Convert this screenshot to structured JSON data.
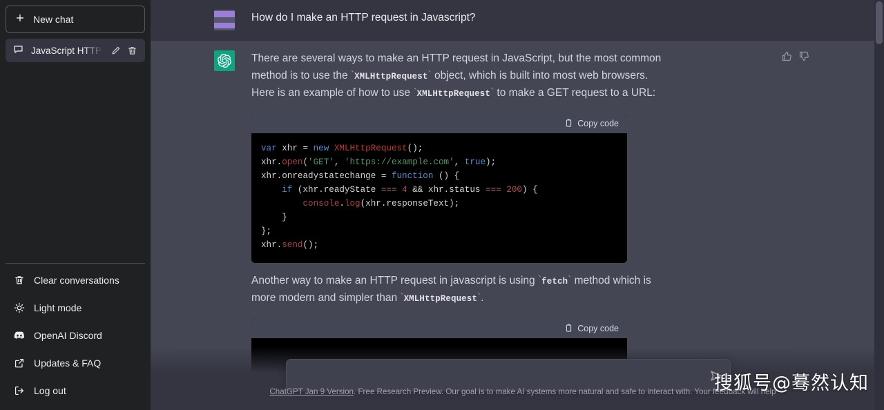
{
  "colors": {
    "sidebar_bg": "#202123",
    "user_row_bg": "#343541",
    "bot_row_bg": "#444654",
    "accent_green": "#10a37f",
    "code_bg": "#000000",
    "code_head_bg": "#434654",
    "composer_bg": "#40414f",
    "text_primary": "#ececf1",
    "text_secondary": "#d1d5db",
    "avatar_user": "#9b7ddc"
  },
  "sidebar": {
    "new_chat_label": "New chat",
    "new_chat_icon": "plus-icon",
    "chats": [
      {
        "title": "JavaScript HTTP requ",
        "icon": "chat-bubble-icon",
        "edit_icon": "pencil-icon",
        "delete_icon": "trash-icon",
        "active": true
      }
    ],
    "menu": [
      {
        "label": "Clear conversations",
        "icon": "trash-icon"
      },
      {
        "label": "Light mode",
        "icon": "sun-icon"
      },
      {
        "label": "OpenAI Discord",
        "icon": "discord-icon"
      },
      {
        "label": "Updates & FAQ",
        "icon": "external-link-icon"
      },
      {
        "label": "Log out",
        "icon": "logout-icon"
      }
    ]
  },
  "conversation": {
    "messages": [
      {
        "role": "user",
        "avatar_icon": "user-avatar",
        "text": "How do I make an HTTP request in Javascript?"
      },
      {
        "role": "assistant",
        "avatar_icon": "openai-logo-icon",
        "feedback": {
          "thumbs_up_icon": "thumbs-up-icon",
          "thumbs_down_icon": "thumbs-down-icon"
        },
        "paragraph_1": {
          "part_1": "There are several ways to make an HTTP request in JavaScript, but the most common method is to use the ",
          "code_1": "XMLHttpRequest",
          "part_2": " object, which is built into most web browsers. Here is an example of how to use ",
          "code_2": "XMLHttpRequest",
          "part_3": " to make a GET request to a URL:"
        },
        "code_block_1": {
          "copy_label": "Copy code",
          "copy_icon": "clipboard-icon",
          "language": "javascript",
          "lines": [
            [
              {
                "t": "var ",
                "c": "k-kw"
              },
              {
                "t": "xhr ",
                "c": "k-plain"
              },
              {
                "t": "= ",
                "c": "k-plain"
              },
              {
                "t": "new ",
                "c": "k-kw"
              },
              {
                "t": "XMLHttpRequest",
                "c": "k-cls"
              },
              {
                "t": "();",
                "c": "k-plain"
              }
            ],
            [
              {
                "t": "xhr.",
                "c": "k-plain"
              },
              {
                "t": "open",
                "c": "k-fn"
              },
              {
                "t": "(",
                "c": "k-plain"
              },
              {
                "t": "'GET'",
                "c": "k-str"
              },
              {
                "t": ", ",
                "c": "k-plain"
              },
              {
                "t": "'https://example.com'",
                "c": "k-str"
              },
              {
                "t": ", ",
                "c": "k-plain"
              },
              {
                "t": "true",
                "c": "k-kw"
              },
              {
                "t": ");",
                "c": "k-plain"
              }
            ],
            [
              {
                "t": "xhr.onreadystatechange = ",
                "c": "k-plain"
              },
              {
                "t": "function",
                "c": "k-kw"
              },
              {
                "t": " () {",
                "c": "k-plain"
              }
            ],
            [
              {
                "t": "    ",
                "c": "k-plain"
              },
              {
                "t": "if",
                "c": "k-kw"
              },
              {
                "t": " (xhr.readyState ",
                "c": "k-plain"
              },
              {
                "t": "===",
                "c": "k-op"
              },
              {
                "t": " ",
                "c": "k-plain"
              },
              {
                "t": "4",
                "c": "k-num"
              },
              {
                "t": " && xhr.status ",
                "c": "k-plain"
              },
              {
                "t": "===",
                "c": "k-op"
              },
              {
                "t": " ",
                "c": "k-plain"
              },
              {
                "t": "200",
                "c": "k-num"
              },
              {
                "t": ") {",
                "c": "k-plain"
              }
            ],
            [
              {
                "t": "        ",
                "c": "k-plain"
              },
              {
                "t": "console",
                "c": "k-fn"
              },
              {
                "t": ".",
                "c": "k-plain"
              },
              {
                "t": "log",
                "c": "k-fn"
              },
              {
                "t": "(xhr.responseText);",
                "c": "k-plain"
              }
            ],
            [
              {
                "t": "    }",
                "c": "k-plain"
              }
            ],
            [
              {
                "t": "};",
                "c": "k-plain"
              }
            ],
            [
              {
                "t": "xhr.",
                "c": "k-plain"
              },
              {
                "t": "send",
                "c": "k-fn"
              },
              {
                "t": "();",
                "c": "k-plain"
              }
            ]
          ]
        },
        "paragraph_2": {
          "part_1": "Another way to make an HTTP request in javascript is using ",
          "code_1": "fetch",
          "part_2": " method which is more modern and simpler than ",
          "code_2": "XMLHttpRequest",
          "part_3": "."
        },
        "code_block_2": {
          "copy_label": "Copy code",
          "copy_icon": "clipboard-icon"
        }
      }
    ]
  },
  "composer": {
    "value": "",
    "placeholder": "",
    "send_icon": "send-arrow-icon"
  },
  "footer": {
    "link_label": "ChatGPT Jan 9 Version",
    "text": ". Free Research Preview. Our goal is to make AI systems more natural and safe to interact with. Your feedback will help"
  },
  "watermark": {
    "text": "搜狐号@蓦然认知"
  }
}
